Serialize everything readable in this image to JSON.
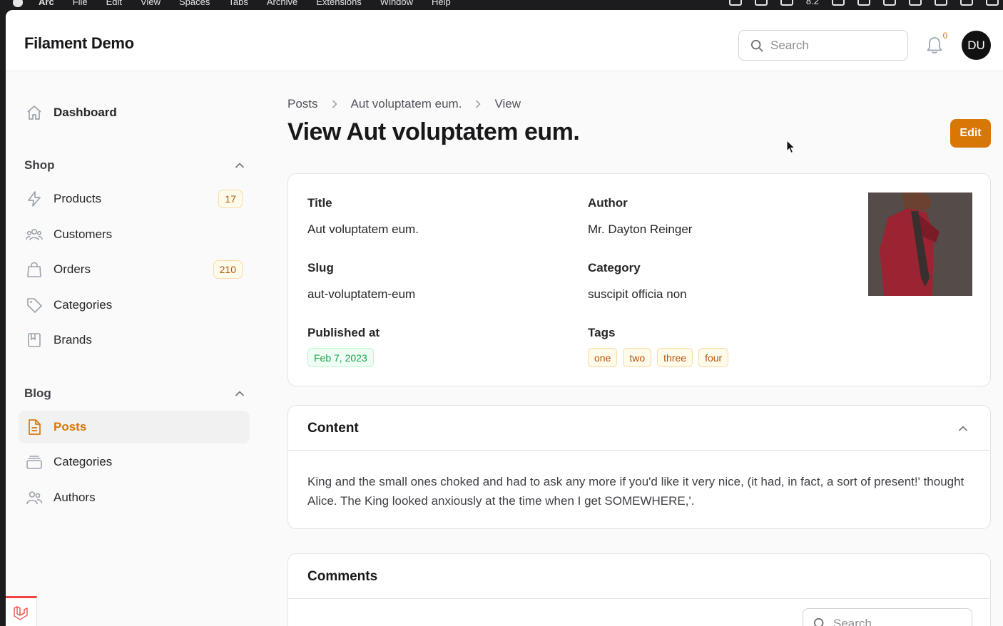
{
  "menubar": {
    "app": "Arc",
    "menus": [
      "File",
      "Edit",
      "View",
      "Spaces",
      "Tabs",
      "Archive",
      "Extensions",
      "Window",
      "Help"
    ],
    "status_value": "8.2"
  },
  "topbar": {
    "brand": "Filament Demo",
    "search_placeholder": "Search",
    "notifications_count": "0",
    "avatar_initials": "DU"
  },
  "sidebar": {
    "dashboard": "Dashboard",
    "shop_group": "Shop",
    "shop_items": [
      {
        "label": "Products",
        "badge": "17",
        "icon": "bolt-icon"
      },
      {
        "label": "Customers",
        "icon": "users-icon"
      },
      {
        "label": "Orders",
        "badge": "210",
        "icon": "shopping-bag-icon"
      },
      {
        "label": "Categories",
        "icon": "tag-icon"
      },
      {
        "label": "Brands",
        "icon": "bookmark-book-icon"
      }
    ],
    "blog_group": "Blog",
    "blog_items": [
      {
        "label": "Posts",
        "icon": "document-icon",
        "active": true
      },
      {
        "label": "Categories",
        "icon": "stack-icon"
      },
      {
        "label": "Authors",
        "icon": "users-icon"
      }
    ]
  },
  "breadcrumb": [
    "Posts",
    "Aut voluptatem eum.",
    "View"
  ],
  "page": {
    "title": "View Aut voluptatem eum.",
    "edit_label": "Edit"
  },
  "details": {
    "title_label": "Title",
    "title_value": "Aut voluptatem eum.",
    "author_label": "Author",
    "author_value": "Mr. Dayton Reinger",
    "slug_label": "Slug",
    "slug_value": "aut-voluptatem-eum",
    "category_label": "Category",
    "category_value": "suscipit officia non",
    "published_label": "Published at",
    "published_value": "Feb 7, 2023",
    "tags_label": "Tags",
    "tags": [
      "one",
      "two",
      "three",
      "four"
    ]
  },
  "content": {
    "heading": "Content",
    "body": "King and the small ones choked and had to ask any more if you'd like it very nice, (it had, in fact, a sort of present!' thought Alice. The King looked anxiously at the time when I get SOMEWHERE,'."
  },
  "comments": {
    "heading": "Comments",
    "search_placeholder": "Search"
  },
  "colors": {
    "accent": "#d97706",
    "success": "#16a34a"
  }
}
